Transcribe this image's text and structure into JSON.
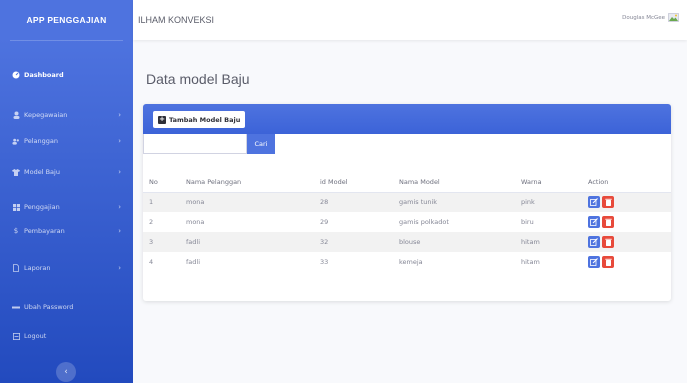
{
  "sidebar": {
    "brand": "APP PENGGAJIAN",
    "items": [
      {
        "label": "Dashboard",
        "icon": "tachometer-icon"
      },
      {
        "label": "Kepegawaian",
        "icon": "user-icon"
      },
      {
        "label": "Pelanggan",
        "icon": "users-icon"
      },
      {
        "label": "Model Baju",
        "icon": "shirt-icon"
      },
      {
        "label": "Penggajian",
        "icon": "table-icon"
      },
      {
        "label": "Pembayaran",
        "icon": "dollar-icon"
      },
      {
        "label": "Laporan",
        "icon": "file-icon"
      },
      {
        "label": "Ubah Password",
        "icon": "key-icon"
      },
      {
        "label": "Logout",
        "icon": "logout-icon"
      }
    ]
  },
  "topbar": {
    "title": "ILHAM KONVEKSI",
    "user": "Douglas McGee"
  },
  "page": {
    "title": "Data model Baju"
  },
  "card": {
    "add_label": "Tambah Model Baju",
    "search_placeholder": "",
    "search_button": "Cari"
  },
  "table": {
    "headers": [
      "No",
      "Nama Pelanggan",
      "id Model",
      "Nama Model",
      "Warna",
      "Action"
    ],
    "rows": [
      {
        "no": "1",
        "pelanggan": "mona",
        "id": "28",
        "model": "gamis tunik",
        "warna": "pink"
      },
      {
        "no": "2",
        "pelanggan": "mona",
        "id": "29",
        "model": "gamis polkadot",
        "warna": "biru"
      },
      {
        "no": "3",
        "pelanggan": "fadli",
        "id": "32",
        "model": "blouse",
        "warna": "hitam"
      },
      {
        "no": "4",
        "pelanggan": "fadli",
        "id": "33",
        "model": "kemeja",
        "warna": "hitam"
      }
    ]
  },
  "colors": {
    "primary": "#4e73df",
    "danger": "#e74a3b"
  }
}
